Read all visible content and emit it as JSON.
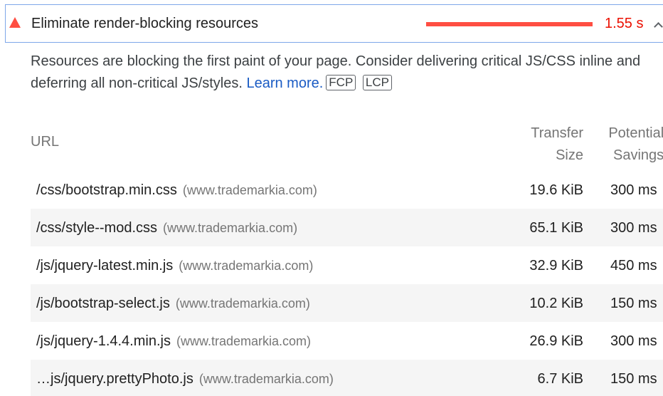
{
  "audit": {
    "title": "Eliminate render-blocking resources",
    "savings_value": "1.55 s",
    "savings_fraction": 1.0,
    "warn_color": "#ff4e42",
    "savings_color": "#eb0f00",
    "icon_status": "warning-triangle-icon",
    "expand_icon": "chevron-up-icon"
  },
  "description": {
    "text": "Resources are blocking the first paint of your page. Consider delivering critical JS/CSS inline and deferring all non-critical JS/styles.",
    "link_label": "Learn more.",
    "link_color": "#1a5bc4",
    "tags": [
      "FCP",
      "LCP"
    ]
  },
  "table": {
    "headers": {
      "url": "URL",
      "size_line1": "Transfer",
      "size_line2": "Size",
      "savings_line1": "Potential",
      "savings_line2": "Savings"
    },
    "rows": [
      {
        "url": "/css/bootstrap.min.css",
        "host": "(www.trademarkia.com)",
        "size": "19.6 KiB",
        "savings": "300 ms"
      },
      {
        "url": "/css/style--mod.css",
        "host": "(www.trademarkia.com)",
        "size": "65.1 KiB",
        "savings": "300 ms"
      },
      {
        "url": "/js/jquery-latest.min.js",
        "host": "(www.trademarkia.com)",
        "size": "32.9 KiB",
        "savings": "450 ms"
      },
      {
        "url": "/js/bootstrap-select.js",
        "host": "(www.trademarkia.com)",
        "size": "10.2 KiB",
        "savings": "150 ms"
      },
      {
        "url": "/js/jquery-1.4.4.min.js",
        "host": "(www.trademarkia.com)",
        "size": "26.9 KiB",
        "savings": "300 ms"
      },
      {
        "url": "…js/jquery.prettyPhoto.js",
        "host": "(www.trademarkia.com)",
        "size": "6.7 KiB",
        "savings": "150 ms"
      }
    ]
  }
}
